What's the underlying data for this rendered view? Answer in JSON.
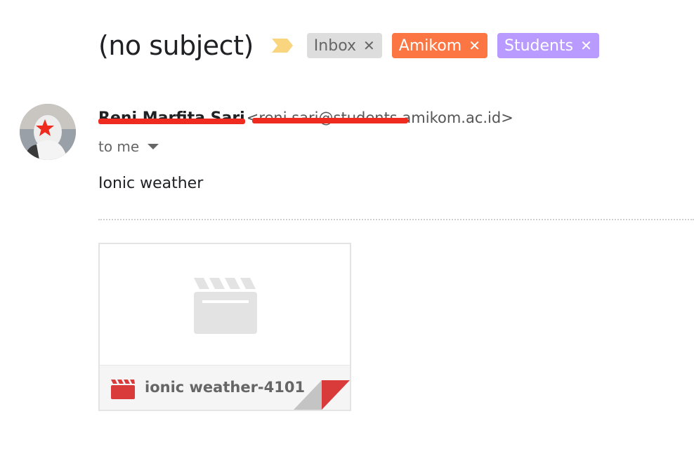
{
  "email": {
    "subject": "(no subject)",
    "sender_name": "Reni Marfita Sari",
    "sender_email": "<reni.sari@students.amikom.ac.id>",
    "recipient": "to me",
    "body": "Ionic weather"
  },
  "labels": [
    {
      "name": "Inbox",
      "remove": "✕",
      "color": "#dddddd"
    },
    {
      "name": "Amikom",
      "remove": "✕",
      "color": "#fb7642"
    },
    {
      "name": "Students",
      "remove": "✕",
      "color": "#b99aff"
    }
  ],
  "attachment": {
    "file_name": "ionic weather-4101",
    "file_type_icon": "video-clapperboard-icon",
    "accent_color": "#d93b3b"
  },
  "icons": {
    "importance": "importance-marker-icon",
    "recipient_dropdown": "chevron-down-icon"
  },
  "colors": {
    "importance_marker": "#f8d57e",
    "redaction": "#ef2b1f"
  }
}
